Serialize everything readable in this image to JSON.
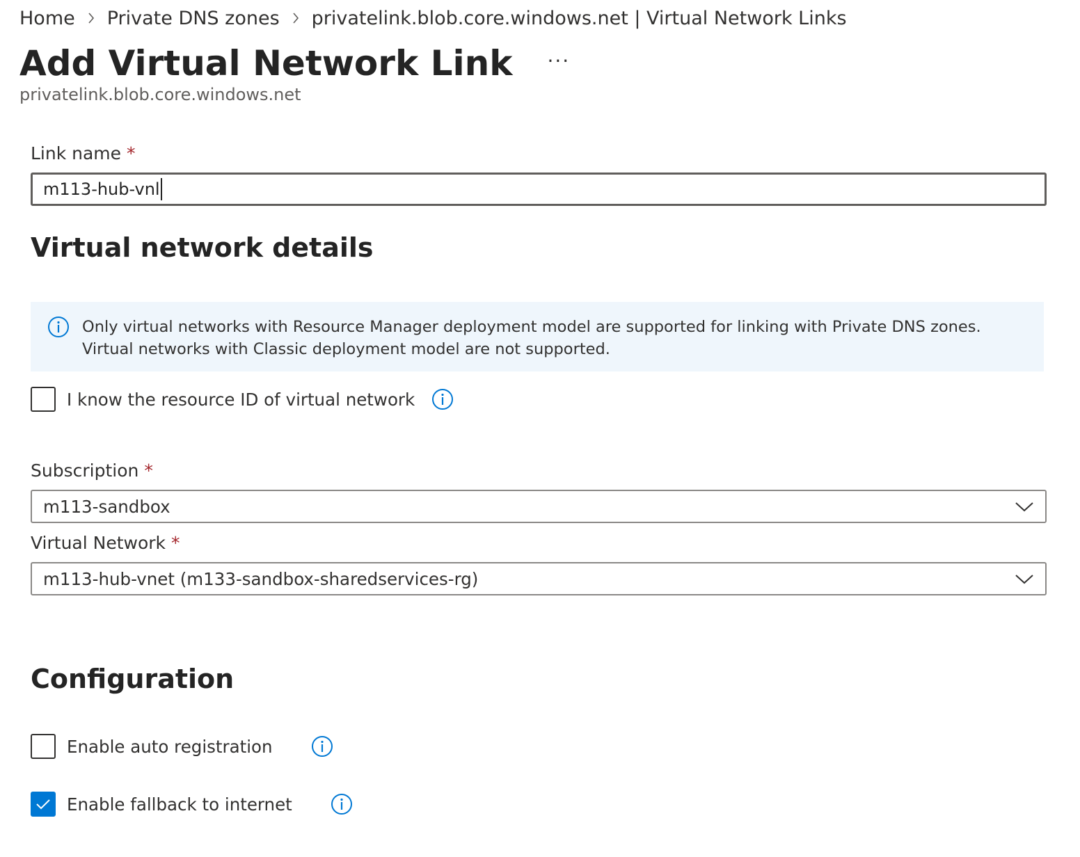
{
  "breadcrumb": {
    "items": [
      "Home",
      "Private DNS zones",
      "privatelink.blob.core.windows.net | Virtual Network Links"
    ]
  },
  "header": {
    "title": "Add Virtual Network Link",
    "more_label": "···",
    "subtitle": "privatelink.blob.core.windows.net"
  },
  "form": {
    "link_name": {
      "label": "Link name",
      "required_marker": "*",
      "value": "m113-hub-vnl"
    },
    "vnet_section": {
      "heading": "Virtual network details",
      "info_banner": "Only virtual networks with Resource Manager deployment model are supported for linking with Private DNS zones. Virtual networks with Classic deployment model are not supported.",
      "resource_id_checkbox": {
        "label": "I know the resource ID of virtual network",
        "checked": false
      },
      "subscription": {
        "label": "Subscription",
        "required_marker": "*",
        "value": "m113-sandbox"
      },
      "virtual_network": {
        "label": "Virtual Network",
        "required_marker": "*",
        "value": "m113-hub-vnet (m133-sandbox-sharedservices-rg)"
      }
    },
    "configuration": {
      "heading": "Configuration",
      "auto_registration": {
        "label": "Enable auto registration",
        "checked": false
      },
      "fallback_internet": {
        "label": "Enable fallback to internet",
        "checked": true
      }
    }
  },
  "colors": {
    "accent": "#0078d4",
    "required": "#a4262c",
    "banner_bg": "#eff6fc",
    "text": "#323130"
  },
  "icons": {
    "breadcrumb_separator": "chevron-right-icon",
    "banner": "info-icon",
    "dropdown": "chevron-down-icon",
    "checked": "checkmark-icon"
  }
}
